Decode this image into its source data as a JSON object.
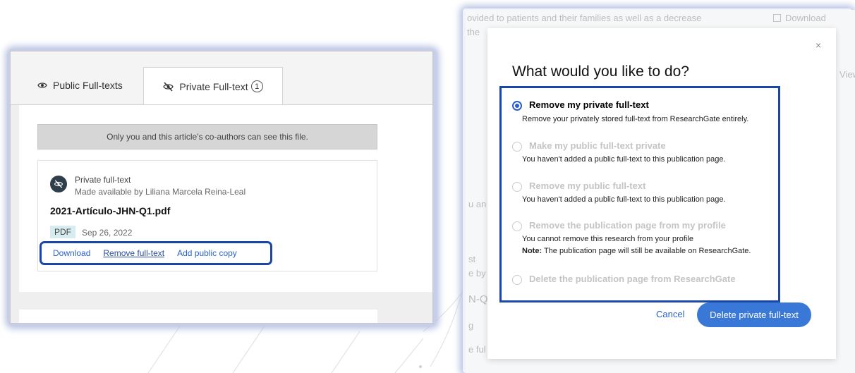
{
  "left": {
    "tabs": [
      {
        "label": "Public Full-texts",
        "icon": "eye-icon"
      },
      {
        "label": "Private Full-text",
        "icon": "eye-off-icon",
        "count": "1"
      }
    ],
    "notice": "Only you and this article's co-authors can see this file.",
    "file": {
      "kind": "Private full-text",
      "made_by": "Made available by Liliana Marcela Reina-Leal",
      "name": "2021-Artículo-JHN-Q1.pdf",
      "type": "PDF",
      "date": "Sep 26, 2022",
      "actions": {
        "download": "Download",
        "remove": "Remove full-text",
        "add_public": "Add public copy"
      }
    }
  },
  "background": {
    "line1": "ovided to patients and their families as well as a decrease",
    "line2": "the",
    "download": "Download",
    "view": "View",
    "frag1": "u an",
    "frag2": "st",
    "frag3": "e by",
    "frag4": "N-Q",
    "frag5": "g",
    "frag6": "e ful"
  },
  "modal": {
    "title": "What would you like to do?",
    "close": "×",
    "options": [
      {
        "label": "Remove my private full-text",
        "desc": "Remove your privately stored full-text from ResearchGate entirely.",
        "selected": true,
        "disabled": false
      },
      {
        "label": "Make my public full-text private",
        "desc": "You haven't added a public full-text to this publication page.",
        "selected": false,
        "disabled": true
      },
      {
        "label": "Remove my public full-text",
        "desc": "You haven't added a public full-text to this publication page.",
        "selected": false,
        "disabled": true
      },
      {
        "label": "Remove the publication page from my profile",
        "desc": "You cannot remove this research from your profile",
        "note_label": "Note:",
        "note": " The publication page will still be available on ResearchGate.",
        "selected": false,
        "disabled": true
      },
      {
        "label": "Delete the publication page from ResearchGate",
        "desc": "",
        "selected": false,
        "disabled": true
      }
    ],
    "cancel": "Cancel",
    "confirm": "Delete private full-text"
  },
  "colors": {
    "accent": "#3a78d8",
    "highlight": "#1947a8",
    "link": "#2a61c9"
  }
}
